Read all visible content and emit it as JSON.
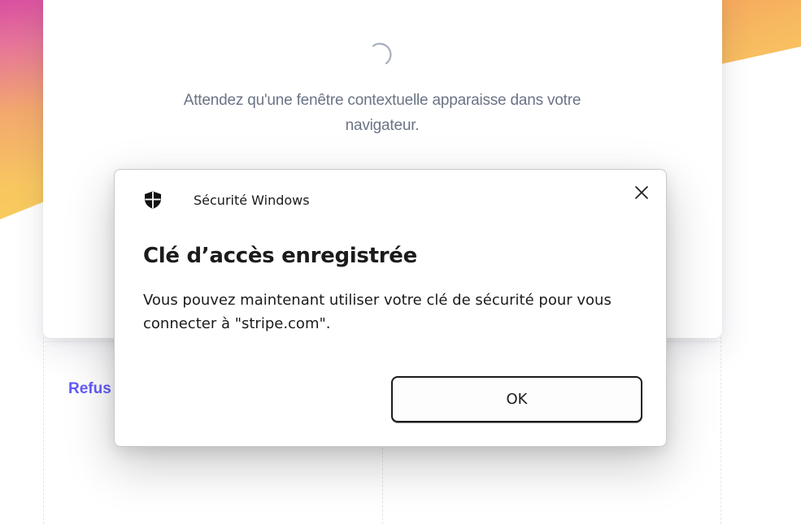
{
  "background_page": {
    "wait_message": "Attendez qu'une fenêtre contextuelle apparaisse dans votre navigateur.",
    "refuse_link": "Refus"
  },
  "dialog": {
    "app_name": "Sécurité Windows",
    "heading": "Clé d’accès enregistrée",
    "message": "Vous pouvez maintenant utiliser votre clé de sécurité pour vous connecter à \"stripe.com\".",
    "ok_label": "OK",
    "icons": {
      "app": "shield-icon",
      "close": "close-icon"
    }
  },
  "colors": {
    "link": "#635bff",
    "muted_text": "#6b7385",
    "gradient_pink": "#d84fa0",
    "gradient_yellow": "#f9cf5c"
  }
}
